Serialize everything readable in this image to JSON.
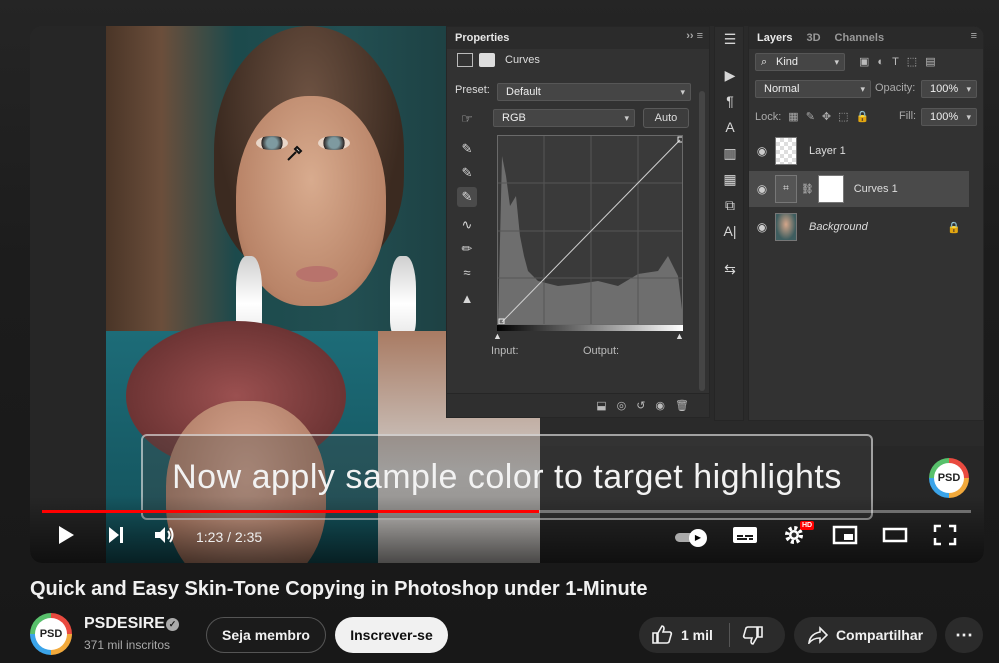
{
  "photoshop": {
    "properties": {
      "panel_title": "Properties",
      "adjustment_name": "Curves",
      "preset_label": "Preset:",
      "preset_value": "Default",
      "channel_value": "RGB",
      "auto_label": "Auto",
      "input_label": "Input:",
      "output_label": "Output:"
    },
    "layers": {
      "tabs": [
        "Layers",
        "3D",
        "Channels"
      ],
      "kind_filter": "Kind",
      "blend_mode": "Normal",
      "opacity_label": "Opacity:",
      "opacity_value": "100%",
      "lock_label": "Lock:",
      "fill_label": "Fill:",
      "fill_value": "100%",
      "items": [
        {
          "name": "Layer 1"
        },
        {
          "name": "Curves 1"
        },
        {
          "name": "Background"
        }
      ]
    }
  },
  "player": {
    "caption": "Now apply sample color to target highlights",
    "watermark_text": "PSD",
    "current_time": "1:23",
    "duration": "2:35",
    "time_display": "1:23 / 2:35",
    "progress_fraction": 0.535,
    "hd_badge": "HD",
    "accent_color": "#ff0000"
  },
  "video": {
    "title": "Quick and Easy Skin-Tone Copying in Photoshop under 1-Minute",
    "channel_name": "PSDESIRE",
    "channel_avatar_text": "PSD",
    "subscribers": "371 mil inscritos",
    "join_label": "Seja membro",
    "subscribe_label": "Inscrever-se",
    "likes": "1 mil",
    "share_label": "Compartilhar",
    "more_label": "⋯"
  }
}
